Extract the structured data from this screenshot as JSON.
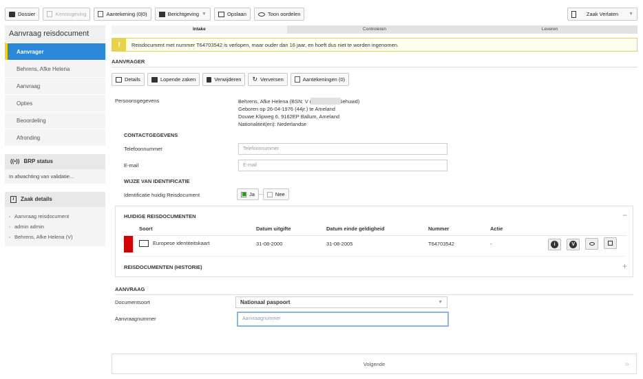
{
  "toolbar": {
    "dossier": "Dossier",
    "kennisgeving": "Kennisgeving",
    "aantekening": "Aantekening (0|0)",
    "berichtgeving": "Berichtgeving",
    "opslaan": "Opslaan",
    "toon_oordelen": "Toon oordelen",
    "zaak_verlaten": "Zaak Verlaten"
  },
  "sidebar": {
    "title": "Aanvraag reisdocument",
    "items": [
      "Aanvrager",
      "Behrens, Afke Helena",
      "Aanvraag",
      "Opties",
      "Beoordeling",
      "Afronding"
    ],
    "brp_title": "BRP status",
    "brp_status": "In afwachting van validatie...",
    "zaak_title": "Zaak details",
    "zaak_items": [
      "Aanvraag reisdocument",
      "admin admin",
      "Behrens, Afke Helena (V)"
    ]
  },
  "steps": [
    "Intake",
    "Controleren",
    "Leveren"
  ],
  "warning": "Reisdocument met nummer T64703542 is verlopen, maar ouder dan 16 jaar, en hoeft dus niet te worden ingenomen.",
  "aanvrager": {
    "heading": "AANVRAGER",
    "buttons": [
      "Details",
      "Lopende zaken",
      "Verwijderen",
      "Verversen",
      "Aantekeningen (0)"
    ],
    "persoons_label": "Persoonsgegevens",
    "persoons_lines": [
      "Behrens, Afke Helena (BSN:               V (vrouwelijk), Gehuwd)",
      "Geboren op 26-04-1976 (44jr.) te Ameland",
      "Douwe Klipweg 6, 9162EP Ballum, Ameland",
      "Nationaliteit(en): Nederlandse"
    ],
    "contact_heading": "CONTACTGEGEVENS",
    "tel_label": "Telefoonnummer",
    "tel_placeholder": "Telefoonnummer",
    "email_label": "E-mail",
    "email_placeholder": "E-mail",
    "id_heading": "WIJZE VAN IDENTIFICATIE",
    "id_label": "Identificatie huidig Reisdocument",
    "ja": "Ja",
    "nee": "Nee"
  },
  "reisdocs": {
    "heading": "HUIDIGE REISDOCUMENTEN",
    "columns": [
      "Soort",
      "Datum uitgifte",
      "Datum einde geldigheid",
      "Nummer",
      "Actie"
    ],
    "rows": [
      {
        "soort": "Europese identiteitskaart",
        "uitgifte": "31-08-2000",
        "einde": "31-08-2005",
        "nummer": "T64703542",
        "actie": "-"
      }
    ],
    "historie": "REISDOCUMENTEN (HISTORIE)",
    "status_color": "#d60000"
  },
  "aanvraag": {
    "heading": "AANVRAAG",
    "docsoort_label": "Documentsoort",
    "docsoort_value": "Nationaal paspoort",
    "nummer_label": "Aanvraagnummer",
    "nummer_placeholder": "Aanvraagnummer"
  },
  "footer": {
    "volgende": "Volgende"
  },
  "colors": {
    "accent": "#2b88d8",
    "highlight": "#f2d600",
    "warning": "#e6d24b"
  }
}
